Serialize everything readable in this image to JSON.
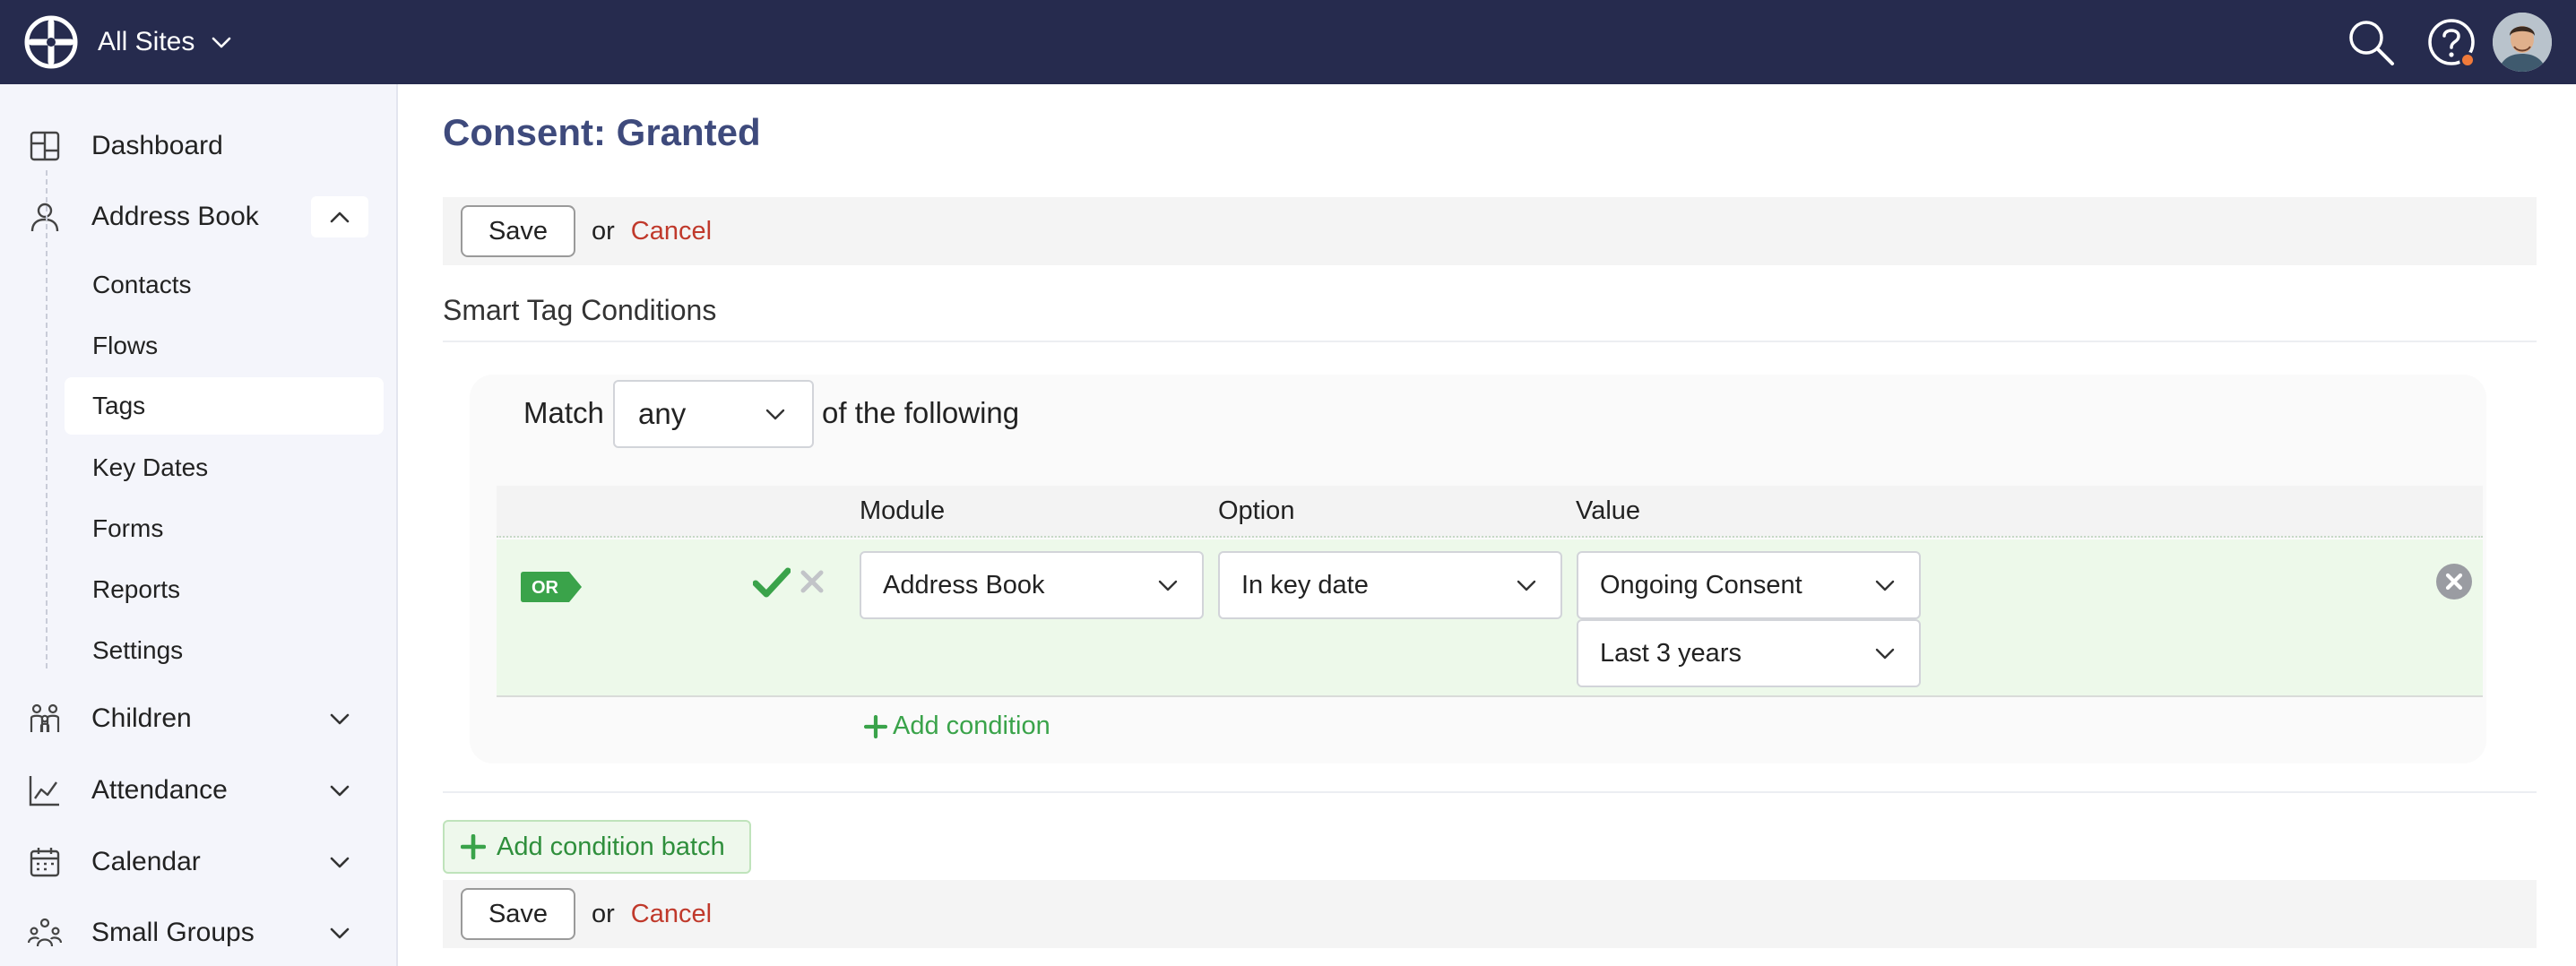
{
  "topbar": {
    "site_switch_label": "All Sites",
    "icons": [
      "logo-icon",
      "chevron-down-icon",
      "search-icon",
      "help-icon",
      "avatar"
    ],
    "notification_color": "#f07a3a",
    "background": "#262b4e"
  },
  "sidebar": {
    "items": [
      {
        "label": "Dashboard",
        "icon": "dashboard-icon"
      },
      {
        "label": "Address Book",
        "icon": "person-icon",
        "expanded": true
      },
      {
        "label": "Children",
        "icon": "children-icon"
      },
      {
        "label": "Attendance",
        "icon": "chart-icon"
      },
      {
        "label": "Calendar",
        "icon": "calendar-icon"
      },
      {
        "label": "Small Groups",
        "icon": "groups-icon"
      }
    ],
    "sub_items": [
      "Contacts",
      "Flows",
      "Tags",
      "Key Dates",
      "Forms",
      "Reports",
      "Settings"
    ],
    "active_sub_item": "Tags"
  },
  "main": {
    "title": "Consent: Granted",
    "actions": {
      "save_label": "Save",
      "or_label": "or",
      "cancel_label": "Cancel"
    },
    "section_title": "Smart Tag Conditions",
    "match": {
      "prefix": "Match",
      "value": "any",
      "suffix": "of the following"
    },
    "table": {
      "headers": [
        "Module",
        "Option",
        "Value"
      ],
      "rows": [
        {
          "tag": "OR",
          "module": "Address Book",
          "option": "In key date",
          "value": "Ongoing Consent",
          "value2": "Last 3 years"
        }
      ]
    },
    "add_condition_label": "Add condition",
    "add_condition_batch_label": "Add condition batch"
  },
  "colors": {
    "title": "#3e4a7c",
    "cancel": "#c0392b",
    "success": "#3aa34a",
    "row_bg": "#edf9ea"
  }
}
